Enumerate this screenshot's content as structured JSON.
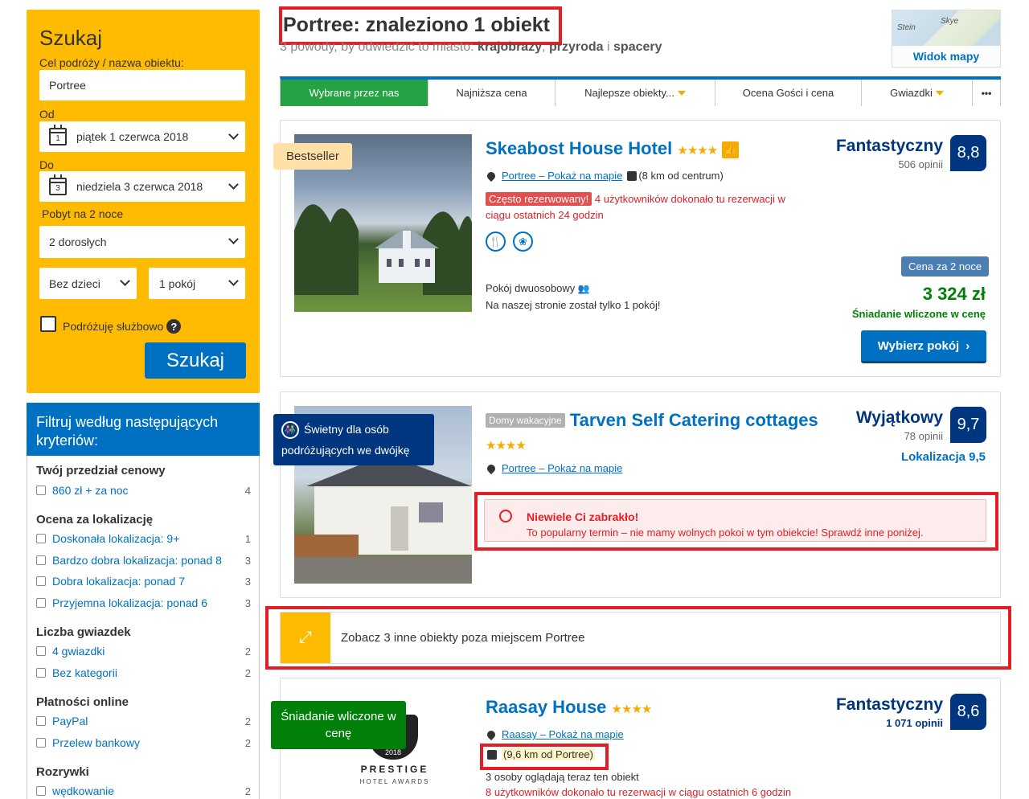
{
  "search": {
    "title": "Szukaj",
    "destination_label": "Cel podróży / nazwa obiektu:",
    "destination_value": "Portree",
    "checkin_label": "Od",
    "checkin_day": "1",
    "checkin_value": "piątek 1 czerwca 2018",
    "checkout_label": "Do",
    "checkout_day": "3",
    "checkout_value": "niedziela 3 czerwca 2018",
    "nights": "Pobyt na 2 noce",
    "adults": "2 dorosłych",
    "children": "Bez dzieci",
    "rooms": "1 pokój",
    "business": "Podróżuję służbowo",
    "help": "?",
    "button": "Szukaj"
  },
  "filter": {
    "heading": "Filtruj według następujących kryteriów:",
    "groups": [
      {
        "title": "Twój przedział cenowy",
        "items": [
          {
            "label": "860 zł + za noc",
            "count": "4"
          }
        ]
      },
      {
        "title": "Ocena za lokalizację",
        "items": [
          {
            "label": "Doskonała lokalizacja: 9+",
            "count": "1"
          },
          {
            "label": "Bardzo dobra lokalizacja: ponad 8",
            "count": "3"
          },
          {
            "label": "Dobra lokalizacja: ponad 7",
            "count": "3"
          },
          {
            "label": "Przyjemna lokalizacja: ponad 6",
            "count": "3"
          }
        ]
      },
      {
        "title": "Liczba gwiazdek",
        "items": [
          {
            "label": "4 gwiazdki",
            "count": "2"
          },
          {
            "label": "Bez kategorii",
            "count": "2"
          }
        ]
      },
      {
        "title": "Płatności online",
        "items": [
          {
            "label": "PayPal",
            "count": "2"
          },
          {
            "label": "Przelew bankowy",
            "count": "2"
          }
        ]
      },
      {
        "title": "Rozrywki",
        "items": [
          {
            "label": "wędkowanie",
            "count": "2"
          }
        ]
      }
    ]
  },
  "header": {
    "title": "Portree: znaleziono 1 obiekt",
    "subtitle_pre": "3 powody, by odwiedzić to miasto: ",
    "reason1": "krajobrazy",
    "sep1": ", ",
    "reason2": "przyroda",
    "sep2": " i ",
    "reason3": "spacery",
    "map_label": "Widok mapy",
    "map_place1": "Skye",
    "map_place2": "Stein"
  },
  "tabs": [
    {
      "label": "Wybrane przez nas"
    },
    {
      "label": "Najniższa cena"
    },
    {
      "label": "Najlepsze obiekty..."
    },
    {
      "label": "Ocena Gości i cena"
    },
    {
      "label": "Gwiazdki"
    },
    {
      "label": "•••"
    }
  ],
  "hotel1": {
    "ribbon": "Bestseller",
    "name": "Skeabost House Hotel",
    "stars": "★★★★",
    "thumb": "👍",
    "location": "Portree – Pokaż na mapie",
    "distance": "(8 km od centrum)",
    "popular_badge": "Często rezerwowany!",
    "popular_text": "4 użytkowników dokonało tu rezerwacji w ciągu ostatnich 24 godzin",
    "rating_word": "Fantastyczny",
    "reviews": "506 opinii",
    "score": "8,8",
    "room": "Pokój dwuosobowy",
    "last_room": "Na naszej stronie został tylko 1 pokój!",
    "price_label": "Cena za 2 noce",
    "price": "3 324 zł",
    "breakfast": "Śniadanie wliczone w cenę",
    "button": "Wybierz pokój"
  },
  "hotel2": {
    "flag": "Świetny dla osób podróżujących we dwójkę",
    "type_badge": "Domy wakacyjne",
    "name": "Tarven Self Catering cottages",
    "stars": "★★★★",
    "location": "Portree – Pokaż na mapie",
    "rating_word": "Wyjątkowy",
    "reviews": "78 opinii",
    "score": "9,7",
    "location_score": "Lokalizacja 9,5",
    "alert_title": "Niewiele Ci zabrakło!",
    "alert_text": "To popularny termin – nie mamy wolnych pokoi w tym obiekcie! Sprawdź inne poniżej."
  },
  "other": {
    "text": "Zobacz 3 inne obiekty poza miejscem Portree"
  },
  "hotel3": {
    "flag": "Śniadanie wliczone w cenę",
    "award_year": "2018",
    "award_title": "PRESTIGE",
    "award_sub": "HOTEL AWARDS",
    "name": "Raasay House",
    "stars": "★★★★",
    "location": "Raasay – Pokaż na mapie",
    "distance": "(9,6 km od Portree)",
    "viewing": "3 osoby oglądają teraz ten obiekt",
    "booked": "8 użytkowników dokonało tu rezerwacji w ciągu ostatnich 6 godzin",
    "rating_word": "Fantastyczny",
    "reviews": "1 071 opinii",
    "score": "8,6"
  },
  "colors": {
    "accent": "#0071c2",
    "search_bg": "#febb02",
    "score_bg": "#003580",
    "green": "#008009",
    "highlight": "#e31e24"
  }
}
